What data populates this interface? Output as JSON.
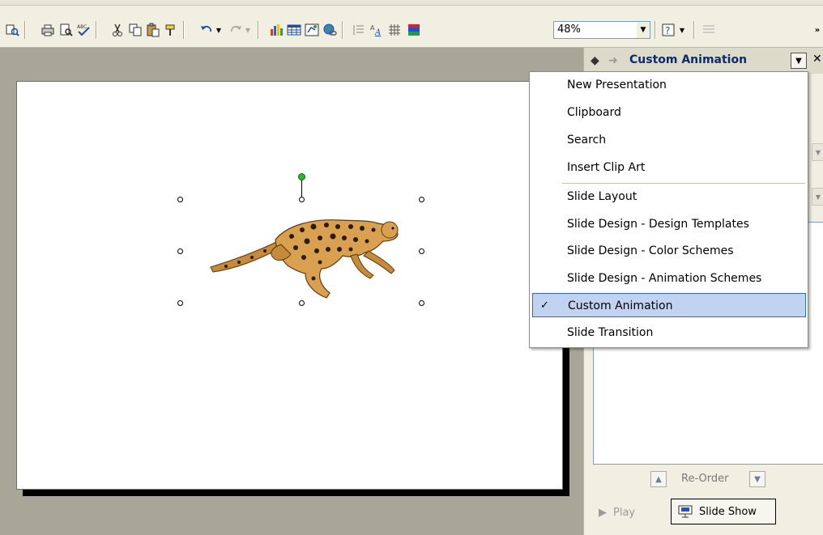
{
  "toolbar": {
    "zoom_value": "48%",
    "icons": [
      "research-icon",
      "print-icon",
      "print-preview-icon",
      "spelling-icon",
      "cut-icon",
      "copy-icon",
      "paste-icon",
      "format-painter-icon",
      "undo-icon",
      "redo-icon",
      "insert-chart-icon",
      "insert-table-icon",
      "insert-diagram-icon",
      "insert-hyperlink-icon",
      "expand-icon",
      "show-formatting-icon",
      "grid-icon",
      "color-icon",
      "help-icon"
    ]
  },
  "task_pane": {
    "title": "Custom Animation",
    "reorder_label": "Re-Order",
    "play_label": "Play",
    "slideshow_label": "Slide Show"
  },
  "menu": {
    "items": [
      {
        "label": "New Presentation",
        "checked": false
      },
      {
        "label": "Clipboard",
        "checked": false
      },
      {
        "label": "Search",
        "checked": false
      },
      {
        "label": "Insert Clip Art",
        "checked": false
      },
      {
        "label": "Slide Layout",
        "checked": false
      },
      {
        "label": "Slide Design - Design Templates",
        "checked": false
      },
      {
        "label": "Slide Design - Color Schemes",
        "checked": false
      },
      {
        "label": "Slide Design - Animation Schemes",
        "checked": false
      },
      {
        "label": "Custom Animation",
        "checked": true
      },
      {
        "label": "Slide Transition",
        "checked": false
      }
    ],
    "check_glyph": "✓"
  },
  "colors": {
    "menu_selected": "#c1d3f0",
    "selection_border": "#316ac5",
    "rotation_handle": "#22c022"
  }
}
